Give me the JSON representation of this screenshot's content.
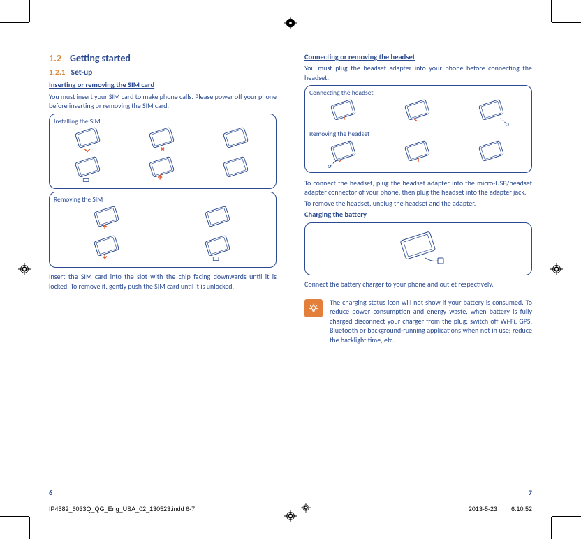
{
  "section": {
    "num": "1.2",
    "title": "Getting started"
  },
  "subsection": {
    "num": "1.2.1",
    "title": "Set-up"
  },
  "left": {
    "heading_sim": "Inserting or removing the SIM card",
    "sim_intro": "You must insert your SIM card to make phone calls. Please power off your phone before inserting or removing the SIM card.",
    "box_install_label": "Installing the SIM",
    "box_remove_label": "Removing the SIM",
    "sim_footer": "Insert the SIM card into the slot with the chip facing downwards until it is locked. To remove it, gently push the SIM card until it is unlocked."
  },
  "right": {
    "heading_headset": "Connecting or removing the headset",
    "headset_intro": "You must plug the headset adapter into your phone before connecting the headset.",
    "box_connect_label": "Connecting the headset",
    "box_remove_label": "Removing the headset",
    "headset_mid1": "To connect the headset, plug the headset adapter into the micro-USB/headset adapter connector of your phone, then plug the headset into the adapter jack.",
    "headset_mid2": "To remove the headset, unplug the headset and the adapter.",
    "heading_charging": "Charging the battery",
    "charging_footer": "Connect the battery charger to your phone and outlet respectively.",
    "tip": "The charging status icon will not show if your battery is consumed. To reduce power consumption and energy waste, when battery is fully charged disconnect your charger from the plug; switch off Wi-Fi, GPS, Bluetooth or background-running applications when not in use; reduce the backlight time, etc."
  },
  "pagenum_left": "6",
  "pagenum_right": "7",
  "footer": {
    "file": "IP4582_6033Q_QG_Eng_USA_02_130523.indd   6-7",
    "date": "2013-5-23",
    "time": "6:10:52"
  }
}
